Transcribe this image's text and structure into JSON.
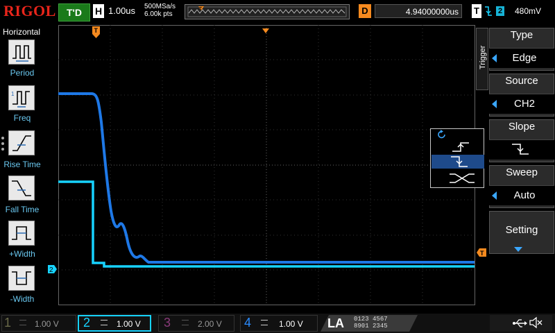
{
  "brand": "RIGOL",
  "status": "T'D",
  "horizontal": {
    "letter": "H",
    "timebase": "1.00us",
    "sample_rate": "500MSa/s",
    "memory_depth": "6.00k pts"
  },
  "delay": {
    "letter": "D",
    "value": "4.94000000us"
  },
  "trigger_status": {
    "letter": "T",
    "source_num": "2",
    "level": "480mV"
  },
  "left_menu": {
    "title": "Horizontal",
    "items": [
      {
        "label": "Period",
        "icon": "period-icon"
      },
      {
        "label": "Freq",
        "icon": "freq-icon"
      },
      {
        "label": "Rise Time",
        "icon": "rise-time-icon"
      },
      {
        "label": "Fall Time",
        "icon": "fall-time-icon"
      },
      {
        "label": "+Width",
        "icon": "positive-width-icon"
      },
      {
        "label": "-Width",
        "icon": "negative-width-icon"
      }
    ]
  },
  "trigger_menu": {
    "side_label": "Trigger",
    "type": {
      "title": "Type",
      "value": "Edge"
    },
    "source": {
      "title": "Source",
      "value": "CH2"
    },
    "slope": {
      "title": "Slope"
    },
    "sweep": {
      "title": "Sweep",
      "value": "Auto"
    },
    "setting": {
      "title": "Setting"
    }
  },
  "markers": {
    "trigger_pos": "T",
    "ch2_ground": "2",
    "trig_level": "T"
  },
  "channels": [
    {
      "num": "1",
      "value": "1.00 V",
      "color": "#7a7a5a",
      "active": false
    },
    {
      "num": "2",
      "value": "1.00 V",
      "color": "#17d3ff",
      "active": true
    },
    {
      "num": "3",
      "value": "2.00 V",
      "color": "#8a3a7a",
      "active": false
    },
    {
      "num": "4",
      "value": "1.00 V",
      "color": "#2a8cff",
      "active": false
    }
  ],
  "la": {
    "label": "LA",
    "groups": [
      "0123",
      "4567",
      "8901",
      "2345"
    ]
  },
  "colors": {
    "ch2": "#17d3ff",
    "ch4": "#1e78e6",
    "accent": "#f58a1f",
    "logo": "#e8251b"
  }
}
